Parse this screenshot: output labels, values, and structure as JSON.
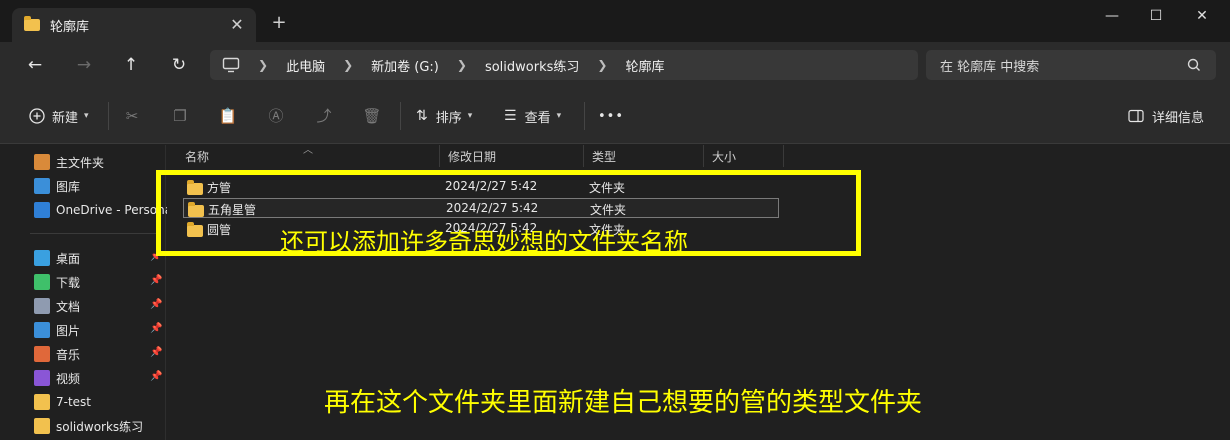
{
  "window": {
    "tab_title": "轮廓库",
    "close_tab": "✕",
    "new_tab": "+",
    "minimize": "—",
    "maximize": "☐",
    "close": "✕"
  },
  "addressbar": {
    "breadcrumbs": [
      "此电脑",
      "新加卷 (G:)",
      "solidworks练习",
      "轮廓库"
    ],
    "search_placeholder": "在 轮廓库 中搜索"
  },
  "toolbar": {
    "new_label": "新建",
    "sort_label": "排序",
    "view_label": "查看",
    "more_label": "•••",
    "details_label": "详细信息"
  },
  "sidebar": {
    "items": [
      {
        "label": "主文件夹",
        "color": "#d98a3a",
        "pinned": false
      },
      {
        "label": "图库",
        "color": "#3b8fd9",
        "pinned": false
      },
      {
        "label": "OneDrive - Persona",
        "color": "#2f7fd6",
        "pinned": false
      },
      {
        "label": "桌面",
        "color": "#3aa0e0",
        "pinned": true
      },
      {
        "label": "下载",
        "color": "#3fc06a",
        "pinned": true
      },
      {
        "label": "文档",
        "color": "#8f9bb0",
        "pinned": true
      },
      {
        "label": "图片",
        "color": "#3b8fd9",
        "pinned": true
      },
      {
        "label": "音乐",
        "color": "#e0683a",
        "pinned": true
      },
      {
        "label": "视频",
        "color": "#8a56d6",
        "pinned": true
      },
      {
        "label": "7-test",
        "color": "#f2c14e",
        "pinned": false
      },
      {
        "label": "solidworks练习",
        "color": "#f2c14e",
        "pinned": false
      }
    ]
  },
  "table": {
    "columns": [
      "名称",
      "修改日期",
      "类型",
      "大小"
    ],
    "rows": [
      {
        "name": "方管",
        "date": "2024/2/27 5:42",
        "type": "文件夹",
        "size": ""
      },
      {
        "name": "五角星管",
        "date": "2024/2/27 5:42",
        "type": "文件夹",
        "size": ""
      },
      {
        "name": "圆管",
        "date": "2024/2/27 5:42",
        "type": "文件夹",
        "size": ""
      }
    ],
    "selected_row": 1
  },
  "annotations": {
    "highlight_text": "还可以添加许多奇思妙想的文件夹名称",
    "bottom_text": "再在这个文件夹里面新建自己想要的管的类型文件夹",
    "color": "#ffff00"
  }
}
